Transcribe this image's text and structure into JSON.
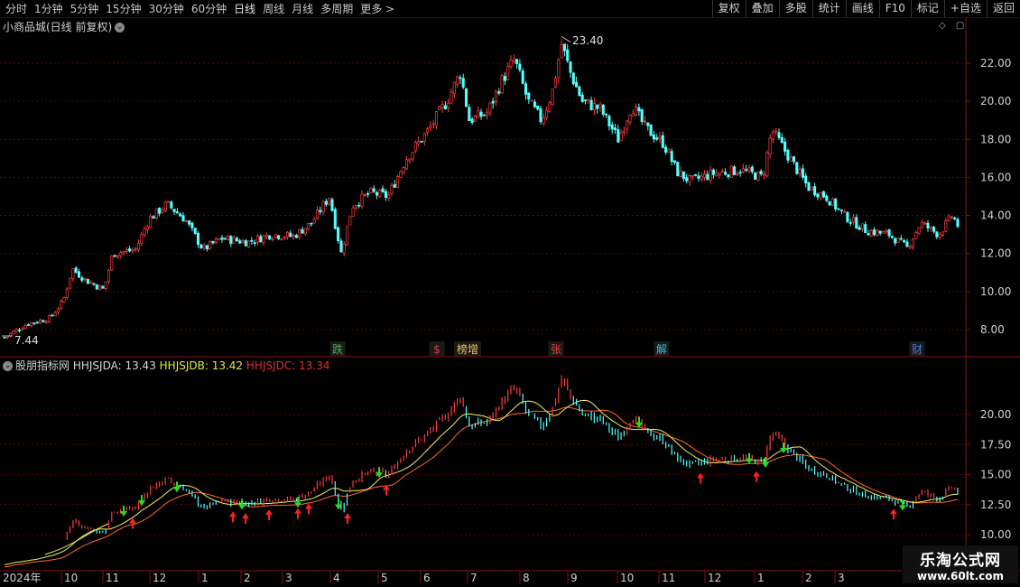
{
  "toolbar": {
    "periods": [
      "分时",
      "1分钟",
      "5分钟",
      "15分钟",
      "30分钟",
      "60分钟",
      "日线",
      "周线",
      "月线",
      "多周期",
      "更多 >"
    ],
    "active_period": "日线",
    "actions": [
      "复权",
      "叠加",
      "多股",
      "统计",
      "画线",
      "F10",
      "标记",
      "+自选",
      "返回"
    ]
  },
  "main_chart": {
    "title": "小商品城(日线 前复权)",
    "high_label": "23.40",
    "low_label": "7.44",
    "y_ticks": [
      "22.00",
      "20.00",
      "18.00",
      "16.00",
      "14.00",
      "12.00",
      "10.00",
      "8.00"
    ],
    "events": [
      {
        "label": "跌",
        "color": "#4CAF50"
      },
      {
        "label": "$",
        "color": "#e23b3b"
      },
      {
        "label": "榜增",
        "color": "#e8c060"
      },
      {
        "label": "张",
        "color": "#e23b3b"
      },
      {
        "label": "解",
        "color": "#3ac0d0"
      },
      {
        "label": "财",
        "color": "#4a7ad8"
      }
    ]
  },
  "indicator": {
    "name": "股朋指标网",
    "values": [
      {
        "label": "HHJSJDA: 13.43",
        "color": "#d8d8d8"
      },
      {
        "label": "HHJSJDB: 13.42",
        "color": "#e8e840"
      },
      {
        "label": "HHJSJDC: 13.34",
        "color": "#e03030"
      }
    ],
    "y_ticks": [
      "20.00",
      "17.50",
      "15.00",
      "12.50",
      "10.00"
    ]
  },
  "x_axis": {
    "year_label": "2024年",
    "months": [
      "10",
      "11",
      "12",
      "1",
      "2",
      "3",
      "4",
      "5",
      "6",
      "7",
      "8",
      "9",
      "10",
      "11",
      "12",
      "1",
      "2",
      "3"
    ]
  },
  "watermark": {
    "title": "乐淘公式网",
    "url": "www.60lt.com"
  },
  "colors": {
    "up": "#ff3c3c",
    "down": "#54ffff",
    "grid": "#7a0000",
    "axis_text": "#d0d0d0"
  },
  "chart_data": {
    "type": "candlestick",
    "title": "小商品城(日线 前复权)",
    "series": [
      {
        "name": "price",
        "x": [
          "2024-09",
          "2024-10",
          "2024-11",
          "2024-12",
          "2025-01",
          "2025-02",
          "2025-03",
          "2025-04",
          "2025-05",
          "2025-06",
          "2025-07",
          "2025-08",
          "2025-09",
          "2025-10",
          "2025-11",
          "2025-12",
          "2026-01",
          "2026-02",
          "2026-03",
          "2026-04"
        ],
        "y": [
          7.44,
          10.5,
          12.0,
          14.2,
          12.5,
          12.8,
          13.0,
          14.0,
          15.0,
          18.5,
          20.5,
          21.5,
          23.4,
          19.5,
          17.5,
          16.5,
          17.0,
          15.5,
          13.0,
          13.4
        ]
      }
    ],
    "ylim": [
      7,
      24
    ],
    "high": 23.4,
    "low": 7.44
  }
}
